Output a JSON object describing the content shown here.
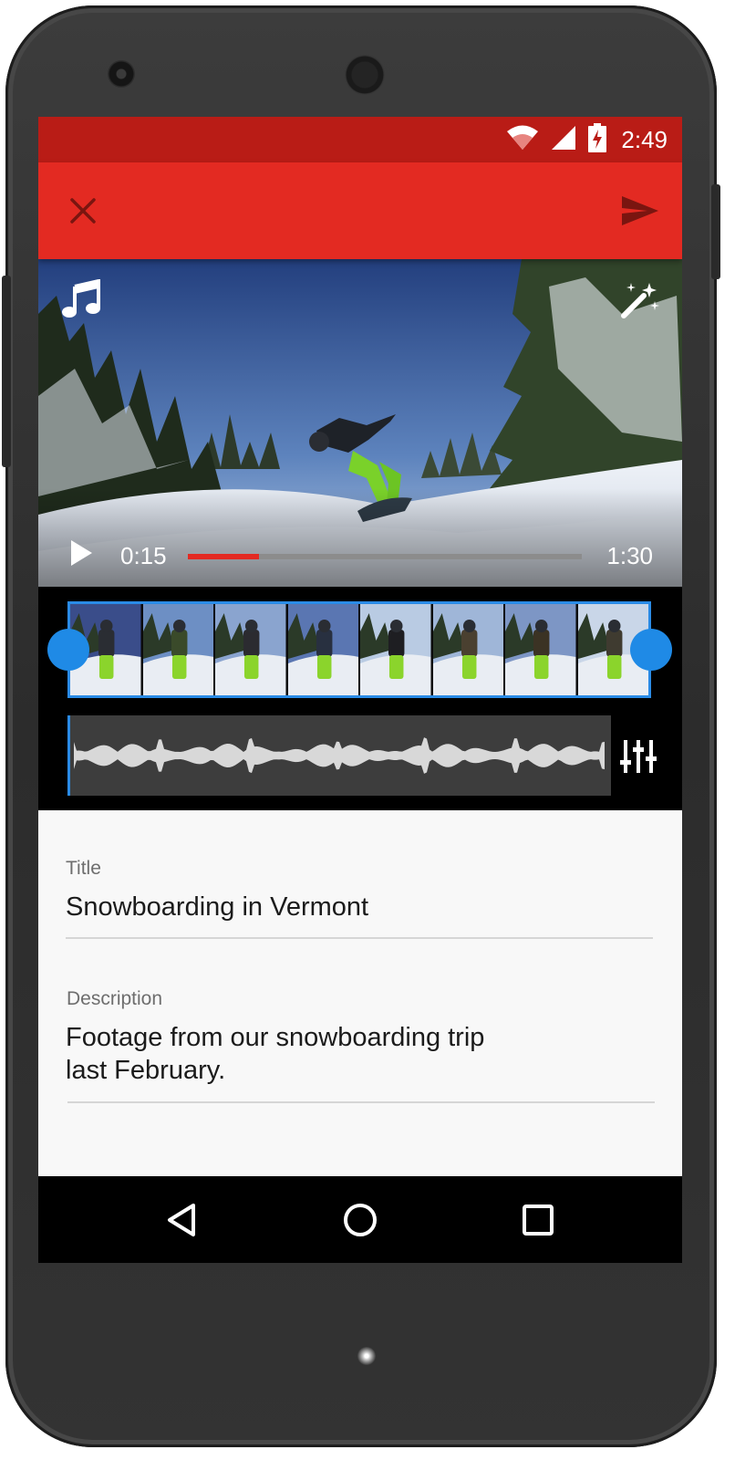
{
  "status_bar": {
    "time": "2:49",
    "icons": [
      "wifi-icon",
      "signal-icon",
      "battery-charging-icon"
    ]
  },
  "app_bar": {
    "close_icon": "close-icon",
    "send_icon": "send-icon"
  },
  "video": {
    "current_time": "0:15",
    "total_time": "1:30",
    "progress": 0.18,
    "music_icon": "music-note-icon",
    "effects_icon": "magic-wand-icon",
    "play_icon": "play-icon"
  },
  "editor": {
    "frame_count": 8,
    "mixer_icon": "mixer-sliders-icon"
  },
  "form": {
    "title_label": "Title",
    "title_value": "Snowboarding in Vermont",
    "description_label": "Description",
    "description_line1": "Footage from our snowboarding trip",
    "description_line2": "last February."
  },
  "nav_bar": {
    "back_icon": "back-icon",
    "home_icon": "home-icon",
    "recents_icon": "recents-icon"
  },
  "colors": {
    "accent_red": "#e32a22",
    "status_red": "#b91c16",
    "trim_blue": "#1f8ae6",
    "progress_red": "#e32a22"
  }
}
